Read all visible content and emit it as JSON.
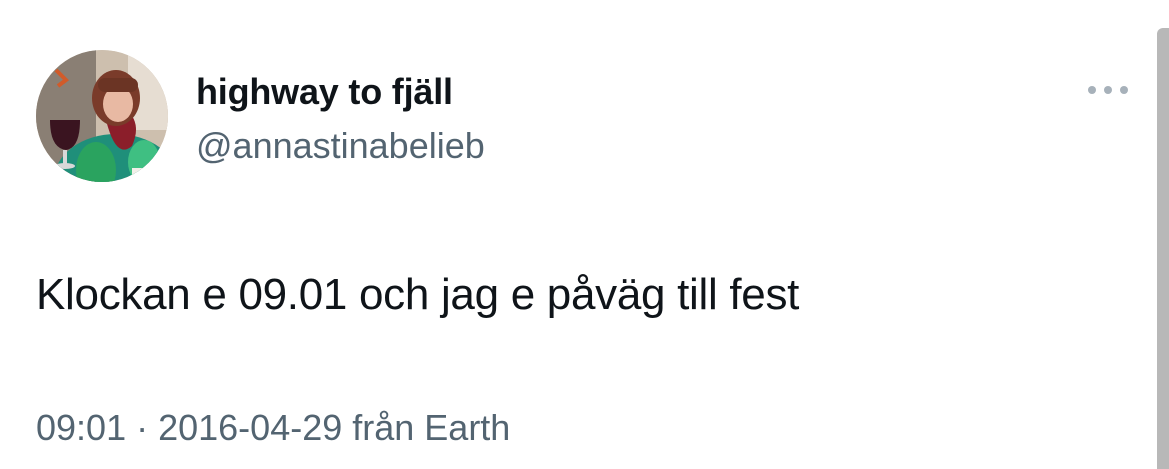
{
  "tweet": {
    "display_name": "highway to fjäll",
    "handle": "@annastinabelieb",
    "text": "Klockan e 09.01 och jag e påväg till fest",
    "time": "09:01",
    "separator": " · ",
    "date": "2016-04-29",
    "source": " från Earth"
  },
  "icons": {
    "avatar": "profile-photo",
    "more": "more-horizontal-icon"
  },
  "colors": {
    "primary_text": "#0f1419",
    "secondary_text": "#536471",
    "background": "#ffffff"
  }
}
